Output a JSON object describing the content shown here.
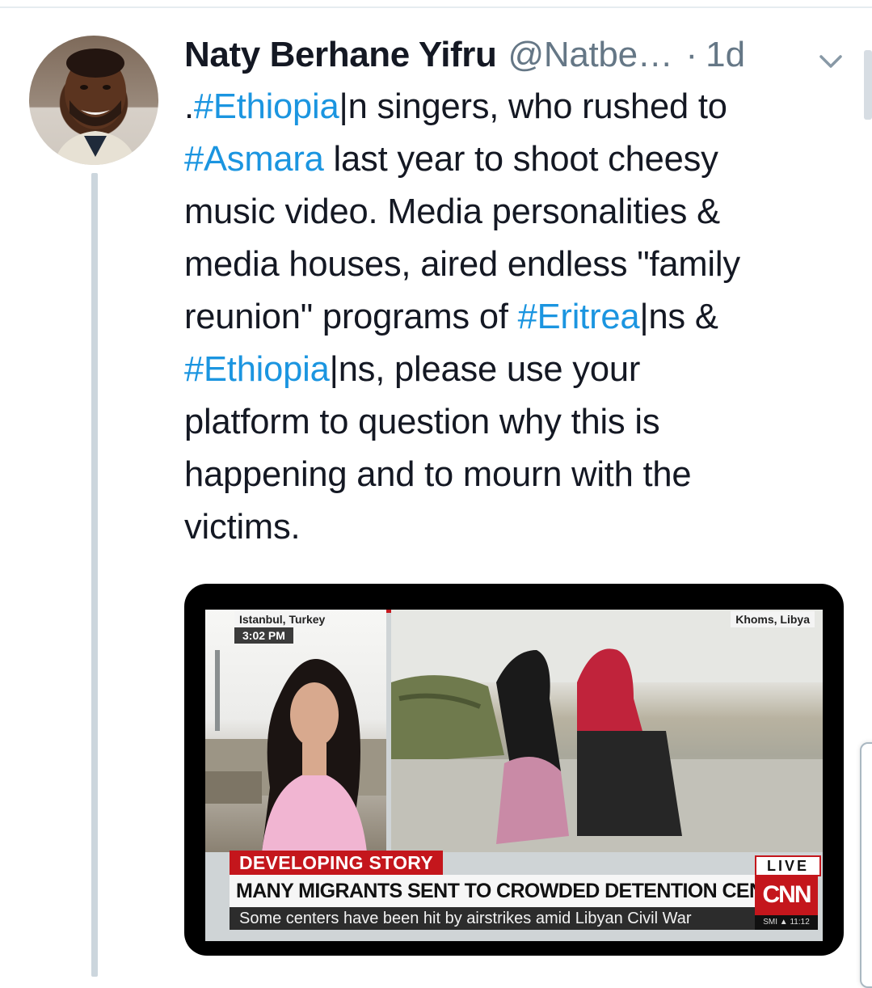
{
  "tweet": {
    "author_name": "Naty Berhane Yifru",
    "handle": "@Natbe…",
    "separator": "·",
    "timestamp": "1d",
    "text_lines": [
      [
        {
          "t": ".",
          "tag": false
        },
        {
          "t": "#Ethiopia",
          "tag": true
        },
        {
          "t": "|n singers, who rushed to",
          "tag": false
        }
      ],
      [
        {
          "t": "#Asmara",
          "tag": true
        },
        {
          "t": " last year to shoot cheesy",
          "tag": false
        }
      ],
      [
        {
          "t": "music video. Media personalities &",
          "tag": false
        }
      ],
      [
        {
          "t": "media houses, aired endless \"family",
          "tag": false
        }
      ],
      [
        {
          "t": "reunion\" programs of ",
          "tag": false
        },
        {
          "t": "#Eritrea",
          "tag": true
        },
        {
          "t": "|ns &",
          "tag": false
        }
      ],
      [
        {
          "t": "#Ethiopia",
          "tag": true
        },
        {
          "t": "|ns, please use your",
          "tag": false
        }
      ],
      [
        {
          "t": "platform to question why this is",
          "tag": false
        }
      ],
      [
        {
          "t": "happening and to mourn with the",
          "tag": false
        }
      ],
      [
        {
          "t": "victims.",
          "tag": false
        }
      ]
    ],
    "hashtag_color": "#1b95e0"
  },
  "media": {
    "location_left": "Istanbul, Turkey",
    "time_left": "3:02 PM",
    "location_right": "Khoms, Libya",
    "banner_label": "DEVELOPING STORY",
    "headline": "MANY MIGRANTS SENT TO CROWDED DETENTION CENTERS",
    "subheadline": "Some centers have been hit by airstrikes amid Libyan Civil War",
    "live_label": "LIVE",
    "network_logo": "CNN",
    "ticker": "SMI ▲ 11:12",
    "brand_color": "#c4161c"
  },
  "icons": {
    "menu": "chevron-down-icon",
    "avatar": "avatar"
  }
}
